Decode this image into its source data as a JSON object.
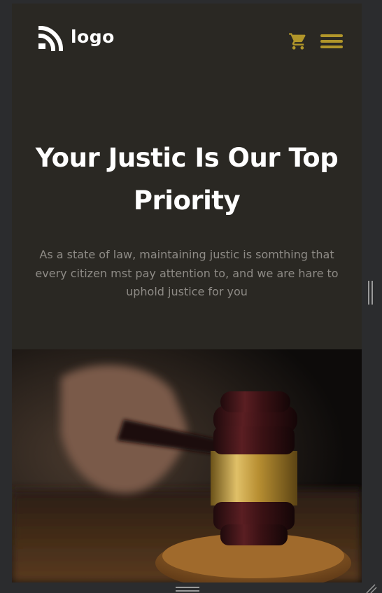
{
  "header": {
    "logo_text": "logo",
    "cart_icon": "shopping-cart-icon",
    "menu_icon": "hamburger-menu-icon"
  },
  "hero": {
    "title": "Your Justic Is Our Top Priority",
    "subtitle": "As a state of law, maintaining justic is somthing that every citizen mst pay attention to, and we are hare to uphold justice for you",
    "image": "judge-gavel-photo"
  },
  "colors": {
    "background": "#2a2823",
    "accent": "#b1962a",
    "title": "#ffffff",
    "subtitle": "#8e8b86",
    "frame": "#2b2c2e"
  }
}
